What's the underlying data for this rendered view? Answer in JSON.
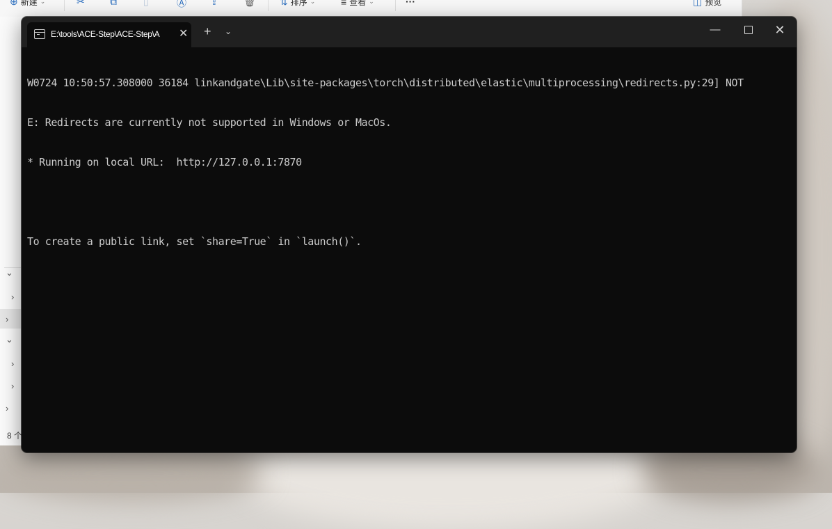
{
  "explorer": {
    "toolbar": {
      "new_label": "新建",
      "sort_label": "排序",
      "view_label": "查看",
      "more_label": "···",
      "preview_label": "预览"
    },
    "status_count": "8 个"
  },
  "terminal": {
    "tab_title": "E:\\tools\\ACE-Step\\ACE-Step\\A",
    "new_tab_label": "+",
    "lines": [
      "W0724 10:50:57.308000 36184 linkandgate\\Lib\\site-packages\\torch\\distributed\\elastic\\multiprocessing\\redirects.py:29] NOT",
      "E: Redirects are currently not supported in Windows or MacOs.",
      "* Running on local URL:  http://127.0.0.1:7870",
      "",
      "To create a public link, set `share=True` in `launch()`."
    ]
  },
  "colors": {
    "terminal_bg": "#0c0c0c",
    "titlebar_bg": "#202020",
    "console_text": "#cccccc",
    "explorer_bg": "#fbfbfb"
  }
}
